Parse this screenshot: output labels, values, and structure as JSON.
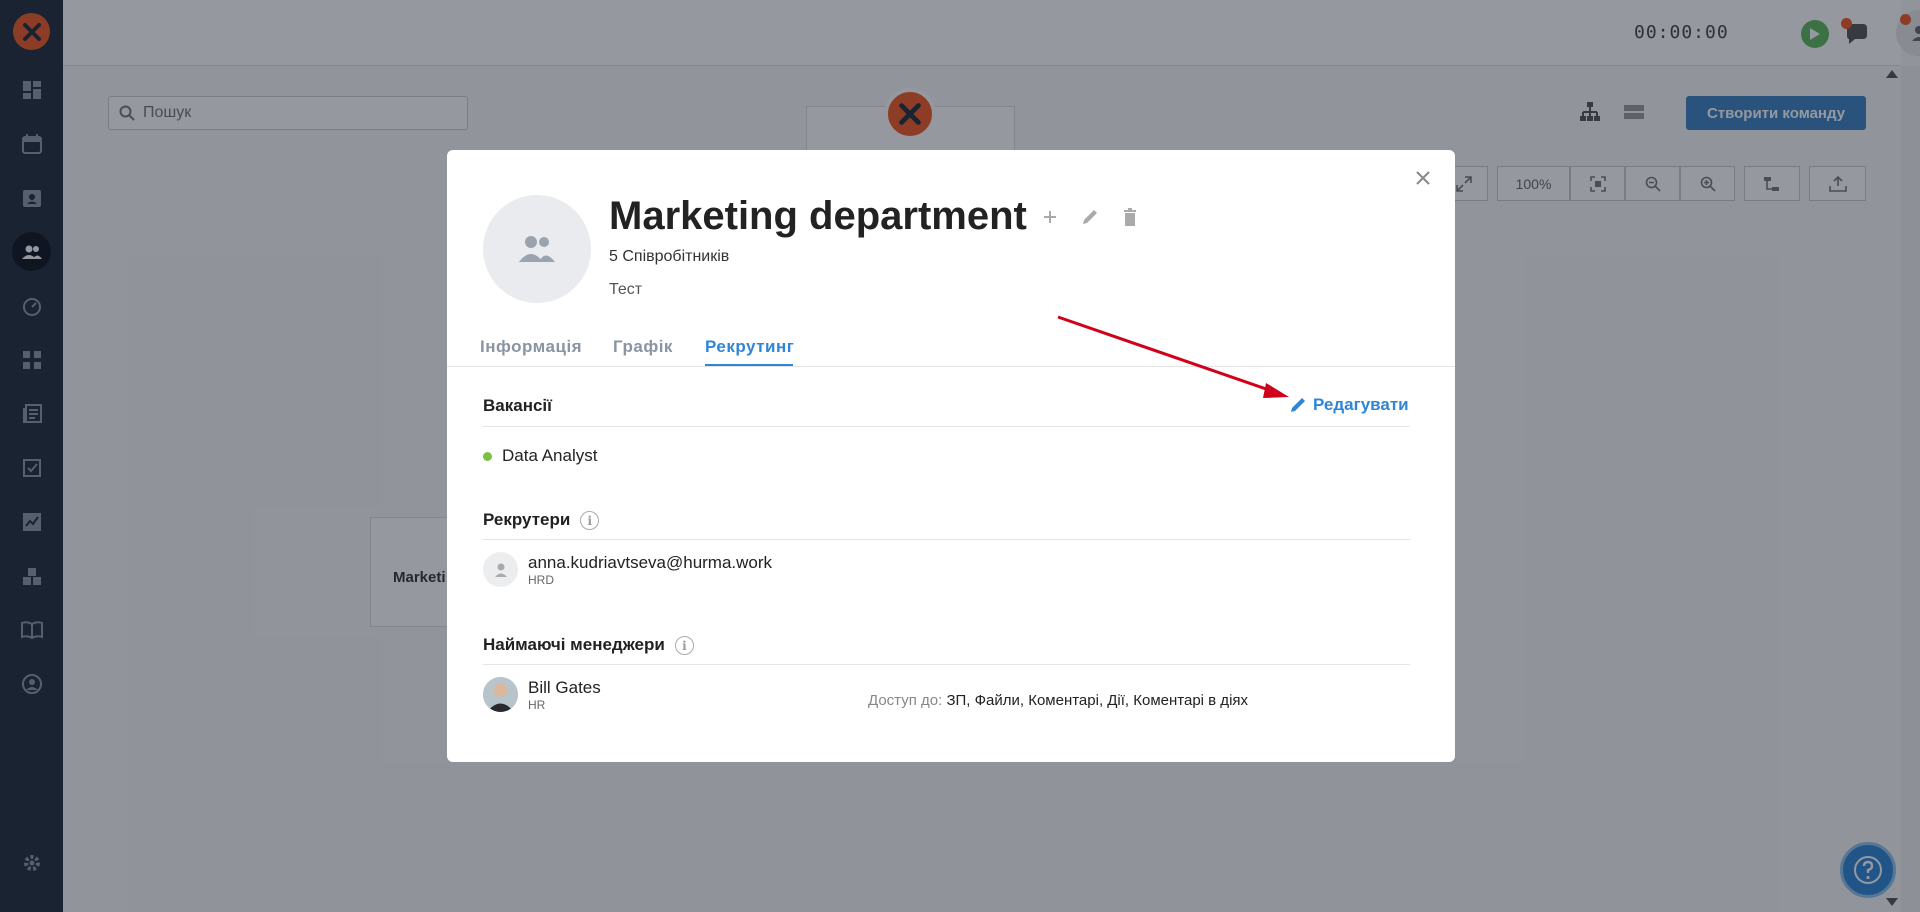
{
  "timer": {
    "display": "00:00:00"
  },
  "search": {
    "placeholder": "Пошук"
  },
  "toolbar": {
    "create_team": "Створити команду",
    "zoom": "100%"
  },
  "background": {
    "org_card_label": "Marketi"
  },
  "modal": {
    "team_name": "Marketing department",
    "employee_count": "5 Співробітників",
    "subtitle": "Тест",
    "tabs": [
      {
        "label": "Інформація"
      },
      {
        "label": "Графік"
      },
      {
        "label": "Рекрутинг"
      }
    ],
    "vacancies": {
      "title": "Вакансії",
      "edit_label": "Редагувати",
      "items": [
        {
          "label": "Data Analyst",
          "status_color": "#7ac143"
        }
      ]
    },
    "recruiters": {
      "title": "Рекрутери",
      "items": [
        {
          "name": "anna.kudriavtseva@hurma.work",
          "role": "HRD"
        }
      ]
    },
    "hiring_managers": {
      "title": "Наймаючі менеджери",
      "items": [
        {
          "name": "Bill Gates",
          "role": "HR",
          "access_label": "Доступ до:",
          "access_value": "ЗП, Файли, Коментарі, Дії, Коментарі в діях"
        }
      ]
    }
  },
  "colors": {
    "accent": "#2f86d6",
    "brand": "#f15a24",
    "sidebar": "#1f2a3a",
    "arrow": "#d0021b"
  }
}
